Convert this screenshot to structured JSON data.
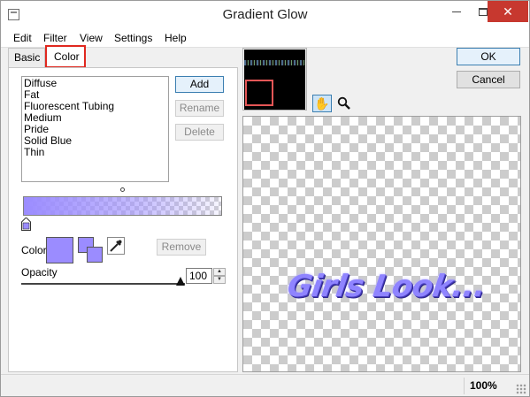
{
  "window": {
    "title": "Gradient Glow"
  },
  "menubar": {
    "items": [
      "Edit",
      "Filter",
      "View",
      "Settings",
      "Help"
    ]
  },
  "tabs": {
    "basic": "Basic",
    "color": "Color",
    "active": "Color"
  },
  "presets": [
    "Diffuse",
    "Fat",
    "Fluorescent Tubing",
    "Medium",
    "Pride",
    "Solid Blue",
    "Thin"
  ],
  "buttons": {
    "add": "Add",
    "rename": "Rename",
    "delete": "Delete",
    "remove": "Remove",
    "ok": "OK",
    "cancel": "Cancel"
  },
  "color": {
    "label": "Color",
    "value": "#9b8cff"
  },
  "opacity": {
    "label": "Opacity",
    "value": "100"
  },
  "preview": {
    "text": "Girls Look..."
  },
  "status": {
    "zoom": "100%"
  },
  "icons": [
    "app-icon",
    "minimize-icon",
    "maximize-icon",
    "close-icon",
    "hand-tool-icon",
    "zoom-tool-icon",
    "eyedropper-icon",
    "gradient-stop-icon",
    "size-grip-icon"
  ]
}
